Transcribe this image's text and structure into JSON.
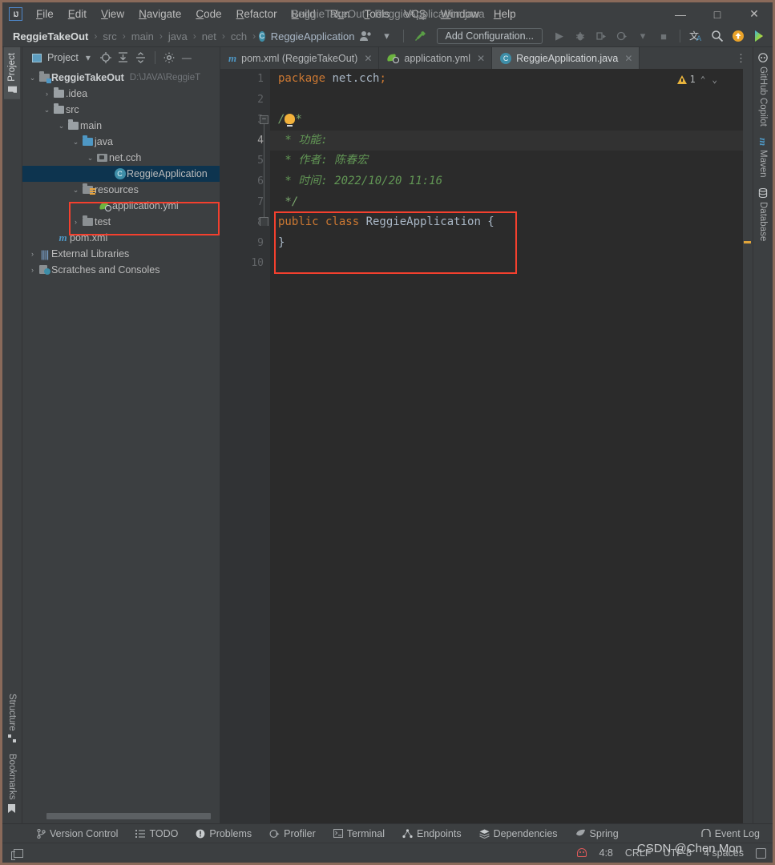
{
  "window": {
    "title": "ReggieTakeOut - ReggieApplication.java",
    "logo": "IJ",
    "minimize": "—",
    "maximize": "□",
    "close": "✕"
  },
  "menu": [
    {
      "label": "File"
    },
    {
      "label": "Edit"
    },
    {
      "label": "View"
    },
    {
      "label": "Navigate"
    },
    {
      "label": "Code"
    },
    {
      "label": "Refactor"
    },
    {
      "label": "Build"
    },
    {
      "label": "Run"
    },
    {
      "label": "Tools"
    },
    {
      "label": "VCS"
    },
    {
      "label": "Window"
    },
    {
      "label": "Help"
    }
  ],
  "breadcrumb": {
    "items": [
      "ReggieTakeOut",
      "src",
      "main",
      "java",
      "net",
      "cch",
      "ReggieApplication"
    ],
    "class_icon": "C",
    "separator": "›"
  },
  "toolbar": {
    "run_configuration": "Add Configuration...",
    "icons": [
      "user-avatar-icon",
      "chevron-down-icon",
      "hammer-build-icon",
      "run-icon",
      "debug-icon",
      "run-with-coverage-icon",
      "profile-icon",
      "chevron-down-icon",
      "stop-icon",
      "translate-icon",
      "search-icon",
      "update-icon",
      "color-picker-icon"
    ]
  },
  "left_strip": {
    "top": [
      {
        "label": "Project",
        "icon": "project-folder-icon",
        "active": true
      }
    ],
    "bottom": [
      {
        "label": "Structure",
        "icon": "structure-icon"
      },
      {
        "label": "Bookmarks",
        "icon": "bookmark-icon"
      }
    ]
  },
  "right_strip": {
    "tabs": [
      {
        "label": "GitHub Copilot",
        "icon": "copilot-icon"
      },
      {
        "label": "Maven",
        "icon": "maven-m-icon"
      },
      {
        "label": "Database",
        "icon": "database-icon"
      }
    ]
  },
  "project_panel": {
    "title": "Project",
    "header_icons": [
      "project-view-select-icon",
      "chevron-down-icon",
      "locate-icon",
      "expand-all-icon",
      "collapse-all-icon",
      "gear-icon",
      "hide-icon"
    ],
    "tree": [
      {
        "depth": 0,
        "arrow": "v",
        "icon": "module-folder-icon",
        "label": "ReggieTakeOut",
        "bold": true,
        "path": "D:\\JAVA\\ReggieT"
      },
      {
        "depth": 1,
        "arrow": ">",
        "icon": "folder-icon",
        "label": ".idea"
      },
      {
        "depth": 1,
        "arrow": "v",
        "icon": "folder-icon",
        "label": "src"
      },
      {
        "depth": 2,
        "arrow": "v",
        "icon": "folder-icon",
        "label": "main"
      },
      {
        "depth": 3,
        "arrow": "v",
        "icon": "source-folder-icon",
        "label": "java"
      },
      {
        "depth": 4,
        "arrow": "v",
        "icon": "package-icon",
        "label": "net.cch"
      },
      {
        "depth": 5,
        "arrow": "",
        "icon": "java-class-icon",
        "label": "ReggieApplication",
        "selected": true
      },
      {
        "depth": 3,
        "arrow": "v",
        "icon": "resources-folder-icon",
        "label": "resources"
      },
      {
        "depth": 4,
        "arrow": "",
        "icon": "yaml-file-icon",
        "label": "application.yml"
      },
      {
        "depth": 3,
        "arrow": ">",
        "icon": "test-folder-icon",
        "label": "test"
      },
      {
        "depth": 2,
        "arrow": "",
        "icon": "maven-file-icon",
        "label": "pom.xml"
      },
      {
        "depth": 0,
        "arrow": ">",
        "icon": "external-libraries-icon",
        "label": "External Libraries"
      },
      {
        "depth": 0,
        "arrow": ">",
        "icon": "scratches-icon",
        "label": "Scratches and Consoles"
      }
    ]
  },
  "editor": {
    "tabs": [
      {
        "label": "pom.xml (ReggieTakeOut)",
        "icon": "maven-file-icon",
        "active": false,
        "close": "✕"
      },
      {
        "label": "application.yml",
        "icon": "yaml-file-icon",
        "active": false,
        "close": "✕"
      },
      {
        "label": "ReggieApplication.java",
        "icon": "java-class-icon",
        "active": true,
        "close": "✕"
      }
    ],
    "overflow_icon": "more-options-icon",
    "inspection": {
      "count": "1",
      "icon": "warning-triangle-icon",
      "prev": "⌃",
      "next": "⌄"
    },
    "line_numbers": [
      "1",
      "2",
      "3",
      "4",
      "5",
      "6",
      "7",
      "8",
      "9",
      "10"
    ],
    "current_line": 4,
    "code_lines": [
      {
        "n": 1,
        "segments": [
          {
            "t": "package ",
            "c": "kw"
          },
          {
            "t": "net.cch",
            "c": "pln"
          },
          {
            "t": ";",
            "c": "semi"
          }
        ]
      },
      {
        "n": 2,
        "segments": []
      },
      {
        "n": 3,
        "segments": [
          {
            "t": "/",
            "c": "cmt-b"
          },
          {
            "t": "BULB",
            "c": "bulb"
          },
          {
            "t": "*",
            "c": "cmt-b"
          }
        ]
      },
      {
        "n": 4,
        "segments": [
          {
            "t": " * 功能:",
            "c": "cmt"
          }
        ]
      },
      {
        "n": 5,
        "segments": [
          {
            "t": " * 作者: 陈春宏",
            "c": "cmt"
          }
        ]
      },
      {
        "n": 6,
        "segments": [
          {
            "t": " * 时间: 2022/10/20 11:16",
            "c": "cmt"
          }
        ]
      },
      {
        "n": 7,
        "segments": [
          {
            "t": " */",
            "c": "cmt-b"
          }
        ]
      },
      {
        "n": 8,
        "segments": [
          {
            "t": "public class ",
            "c": "kw"
          },
          {
            "t": "ReggieApplication",
            "c": "cls"
          },
          {
            "t": " {",
            "c": "brace"
          }
        ]
      },
      {
        "n": 9,
        "segments": [
          {
            "t": "}",
            "c": "brace"
          }
        ]
      },
      {
        "n": 10,
        "segments": []
      }
    ]
  },
  "bottom_bar": {
    "tabs": [
      {
        "label": "Version Control",
        "icon": "branch-icon"
      },
      {
        "label": "TODO",
        "icon": "list-icon"
      },
      {
        "label": "Problems",
        "icon": "exclamation-circle-icon"
      },
      {
        "label": "Profiler",
        "icon": "profiler-icon"
      },
      {
        "label": "Terminal",
        "icon": "terminal-icon"
      },
      {
        "label": "Endpoints",
        "icon": "endpoints-icon"
      },
      {
        "label": "Dependencies",
        "icon": "layers-icon"
      },
      {
        "label": "Spring",
        "icon": "spring-leaf-icon"
      }
    ],
    "event_log": {
      "label": "Event Log",
      "icon": "event-log-icon"
    }
  },
  "status_bar": {
    "caret_position": "4:8",
    "line_separator": "CRLF",
    "encoding": "UTF-8",
    "indent": "4 spaces",
    "android_icon": "android-robot-icon",
    "lock_icon": "read-only-lock-icon",
    "window_icon": "tool-window-icon"
  },
  "watermark": "CSDN @Chen Mon",
  "colors": {
    "frame_border": "#8a6a5a",
    "chrome": "#3c3f41",
    "editor_bg": "#2b2b2b",
    "gutter_bg": "#313335",
    "selection": "#0d344f",
    "highlight_box": "#f4402e",
    "keyword": "#cc7832",
    "comment": "#629755",
    "accent_blue": "#4e97c4"
  }
}
